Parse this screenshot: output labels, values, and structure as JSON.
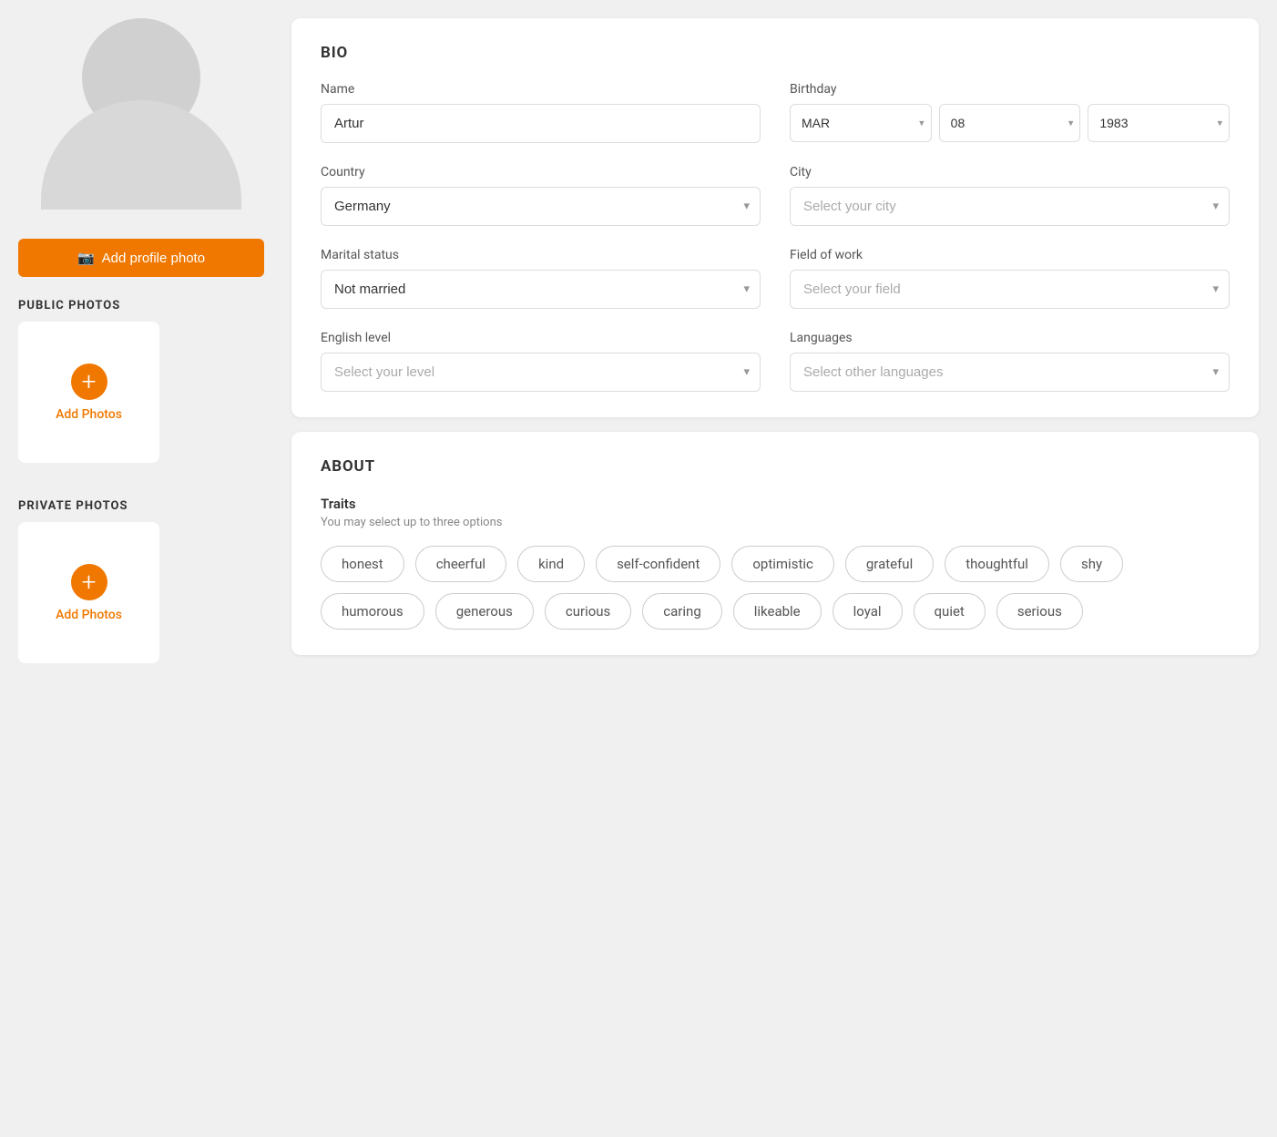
{
  "sidebar": {
    "add_photo_btn": "Add profile photo",
    "public_photos_label": "PUBLIC PHOTOS",
    "public_add_photos": "Add Photos",
    "private_photos_label": "PRIVATE PHOTOS",
    "private_add_photos": "Add Photos"
  },
  "bio": {
    "title": "BIO",
    "name_label": "Name",
    "name_value": "Artur",
    "birthday_label": "Birthday",
    "birthday_month": "MAR",
    "birthday_day": "08",
    "birthday_year": "1983",
    "country_label": "Country",
    "country_value": "Germany",
    "city_label": "City",
    "city_placeholder": "Select your city",
    "marital_label": "Marital status",
    "marital_value": "Not married",
    "field_label": "Field of work",
    "field_placeholder": "Select your field",
    "english_label": "English level",
    "english_placeholder": "Select your level",
    "languages_label": "Languages",
    "languages_placeholder": "Select other languages"
  },
  "about": {
    "title": "ABOUT",
    "traits_label": "Traits",
    "traits_subtitle": "You may select up to three options",
    "traits": [
      {
        "id": "honest",
        "label": "honest"
      },
      {
        "id": "cheerful",
        "label": "cheerful"
      },
      {
        "id": "kind",
        "label": "kind"
      },
      {
        "id": "self-confident",
        "label": "self-confident"
      },
      {
        "id": "optimistic",
        "label": "optimistic"
      },
      {
        "id": "grateful",
        "label": "grateful"
      },
      {
        "id": "thoughtful",
        "label": "thoughtful"
      },
      {
        "id": "shy",
        "label": "shy"
      },
      {
        "id": "humorous",
        "label": "humorous"
      },
      {
        "id": "generous",
        "label": "generous"
      },
      {
        "id": "curious",
        "label": "curious"
      },
      {
        "id": "caring",
        "label": "caring"
      },
      {
        "id": "likeable",
        "label": "likeable"
      },
      {
        "id": "loyal",
        "label": "loyal"
      },
      {
        "id": "quiet",
        "label": "quiet"
      },
      {
        "id": "serious",
        "label": "serious"
      }
    ]
  },
  "icons": {
    "camera": "📷",
    "chevron_down": "▾",
    "plus": "+"
  }
}
